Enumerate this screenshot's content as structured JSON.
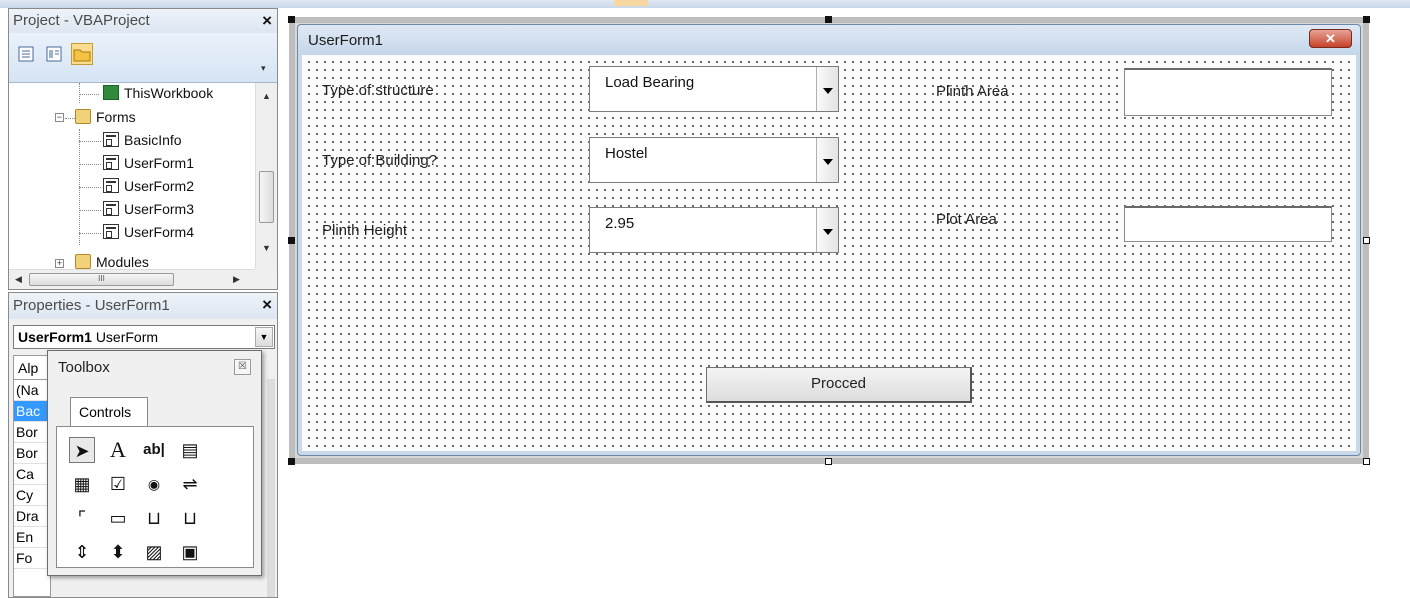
{
  "project_pane": {
    "title": "Project - VBAProject",
    "close_glyph": "×",
    "tree": [
      {
        "label": "ThisWorkbook",
        "icon": "workbook-icon"
      },
      {
        "label": "Forms",
        "icon": "folder-icon"
      },
      {
        "label": "BasicInfo",
        "icon": "form-icon"
      },
      {
        "label": "UserForm1",
        "icon": "form-icon"
      },
      {
        "label": "UserForm2",
        "icon": "form-icon"
      },
      {
        "label": "UserForm3",
        "icon": "form-icon"
      },
      {
        "label": "UserForm4",
        "icon": "form-icon"
      },
      {
        "label": "Modules",
        "icon": "folder-icon"
      }
    ],
    "hscroll_glyph": "III"
  },
  "properties_pane": {
    "title": "Properties - UserForm1",
    "close_glyph": "×",
    "object_name": "UserForm1",
    "object_type": "UserForm",
    "tab_label": "Alp",
    "rows": [
      "(Na",
      "Bac",
      "Bor",
      "Bor",
      "Ca",
      "Cy",
      "Dra",
      "En",
      "Fo"
    ],
    "selected_row_index": 1
  },
  "toolbox": {
    "title": "Toolbox",
    "close_glyph": "☒",
    "tab_label": "Controls",
    "tools": [
      {
        "name": "select-objects-tool",
        "glyph": "➤"
      },
      {
        "name": "label-tool",
        "glyph": "A"
      },
      {
        "name": "textbox-tool",
        "glyph": "ab|"
      },
      {
        "name": "combobox-tool",
        "glyph": "▤"
      },
      {
        "name": "listbox-tool",
        "glyph": "▦"
      },
      {
        "name": "checkbox-tool",
        "glyph": "☑"
      },
      {
        "name": "optionbutton-tool",
        "glyph": "◉"
      },
      {
        "name": "togglebutton-tool",
        "glyph": "⇌"
      },
      {
        "name": "frame-tool",
        "glyph": "⌜"
      },
      {
        "name": "commandbutton-tool",
        "glyph": "▭"
      },
      {
        "name": "tabstrip-tool",
        "glyph": "⊔"
      },
      {
        "name": "multipage-tool",
        "glyph": "⊔"
      },
      {
        "name": "scrollbar-tool",
        "glyph": "⇕"
      },
      {
        "name": "spinbutton-tool",
        "glyph": "⬍"
      },
      {
        "name": "image-tool",
        "glyph": "▨"
      },
      {
        "name": "refedit-tool",
        "glyph": "▣"
      }
    ]
  },
  "userform": {
    "title": "UserForm1",
    "close_glyph": "✕",
    "labels": {
      "type_of_structure": "Type of structure",
      "type_of_building": "Type of Building?",
      "plinth_height": "Plinth Height",
      "plinth_area": "Plinth Area",
      "plot_area": "Plot Area"
    },
    "combos": {
      "type_of_structure": "Load Bearing",
      "type_of_building": "Hostel",
      "plinth_height": "2.95"
    },
    "textboxes": {
      "plinth_area": "",
      "plot_area": ""
    },
    "button_label": "Procced"
  }
}
